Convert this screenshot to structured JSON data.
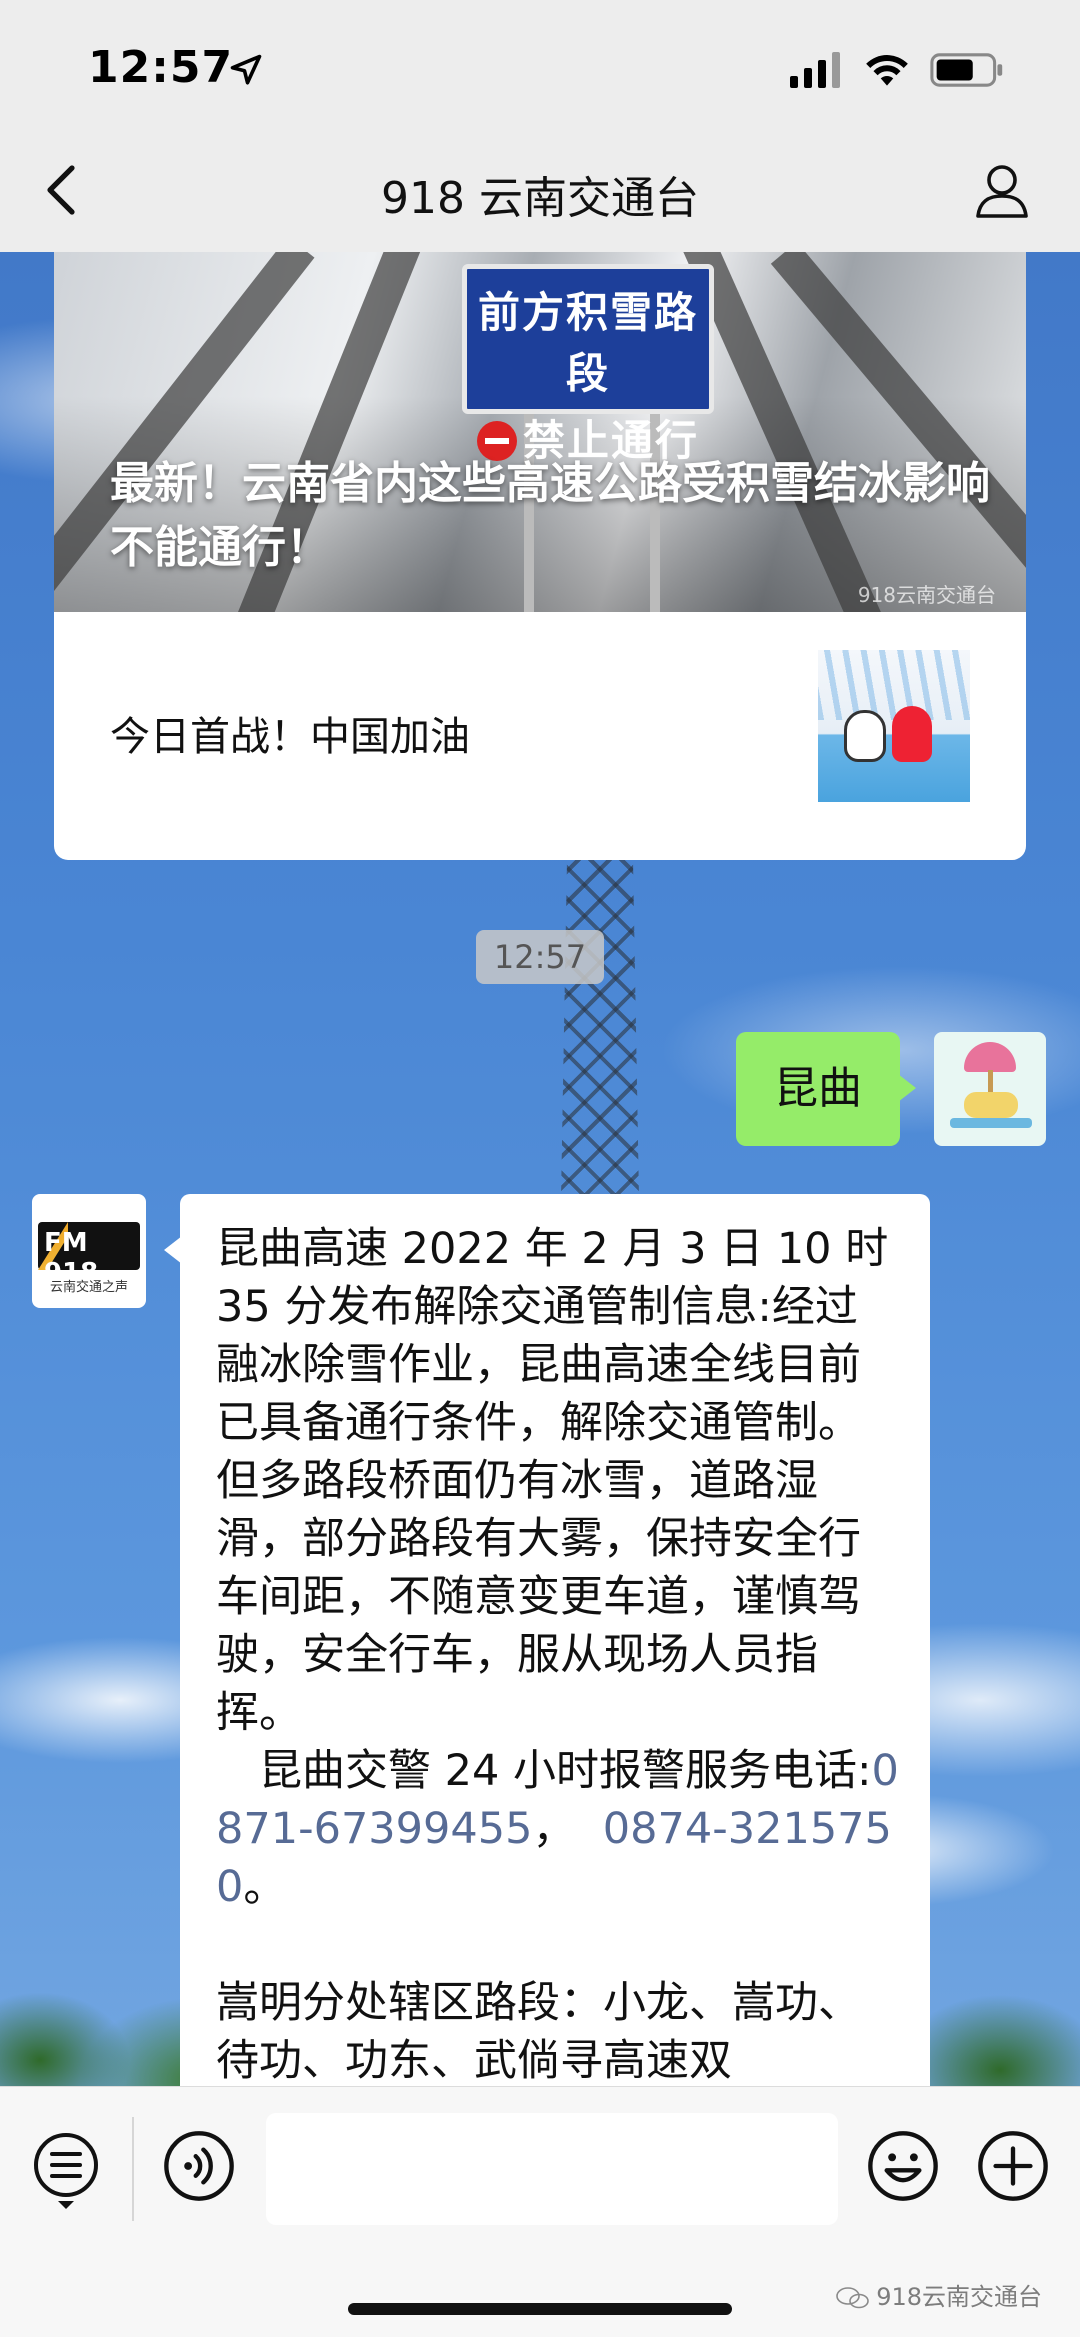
{
  "status_bar": {
    "time": "12:57"
  },
  "nav": {
    "title": "918 云南交通台"
  },
  "article": {
    "cover_sign_line1": "前方积雪路段",
    "cover_sign_line2": "禁止通行",
    "cover_title": "最新！云南省内这些高速公路受积雪结冰影响不能通行！",
    "cover_watermark": "918云南交通台",
    "item_title": "今日首战！中国加油"
  },
  "chat": {
    "timestamp": "12:57",
    "outgoing_message": "昆曲",
    "incoming_avatar_text": "FM 918",
    "incoming_avatar_caption": "云南交通之声",
    "incoming_message": {
      "paragraph1": "昆曲高速 2022 年 2 月 3 日 10 时 35 分发布解除交通管制信息:经过融冰除雪作业，昆曲高速全线目前已具备通行条件，解除交通管制。但多路段桥面仍有冰雪，道路湿滑，部分路段有大雾，保持安全行车间距，不随意变更车道，谨慎驾驶，安全行车，服从现场人员指挥。",
      "paragraph2_prefix": "　昆曲交警 24 小时报警服务电话:",
      "phone1": "0871-67399455",
      "separator": "，  ",
      "phone2": "0874-3215750",
      "paragraph2_suffix": "。",
      "paragraph3": "嵩明分处辖区路段：小龙、嵩功、待功、功东、武倘寻高速双"
    }
  },
  "input_bar": {
    "placeholder": ""
  },
  "watermark": "918云南交通台",
  "icons": [
    "location-arrow-icon",
    "signal-icon",
    "wifi-icon",
    "battery-icon",
    "back-chevron-icon",
    "profile-icon",
    "menu-list-icon",
    "voice-icon",
    "emoji-icon",
    "plus-icon"
  ],
  "colors": {
    "outgoing_bubble": "#95ec69",
    "link": "#576b95",
    "top_bar": "#ededed"
  }
}
